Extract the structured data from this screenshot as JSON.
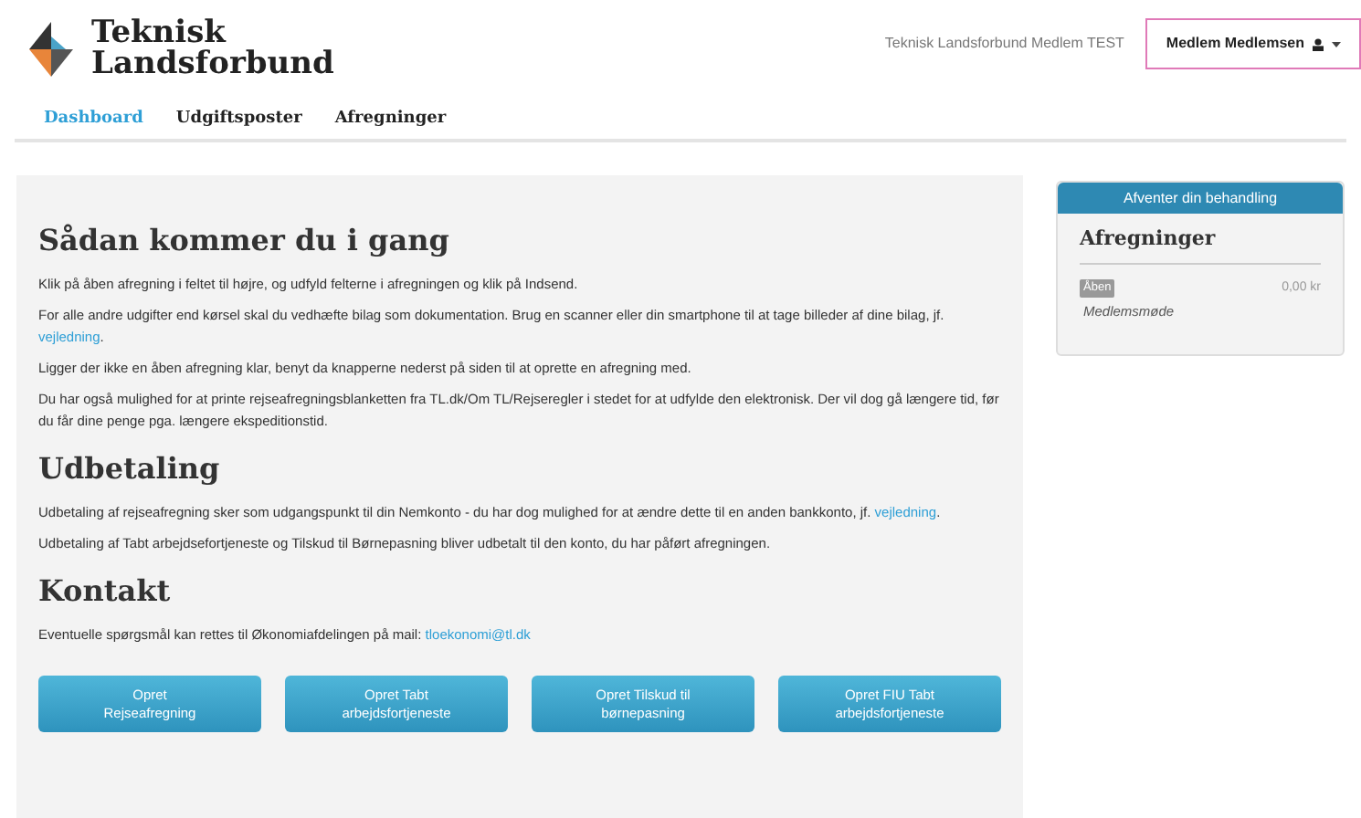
{
  "logo": {
    "line_1": "Teknisk",
    "line_2": "Landsforbund"
  },
  "header": {
    "org": "Teknisk Landsforbund Medlem TEST",
    "user": "Medlem Medlemsen"
  },
  "nav": [
    {
      "label": "Dashboard",
      "selected": true
    },
    {
      "label": "Udgiftsposter",
      "selected": false
    },
    {
      "label": "Afregninger",
      "selected": false
    }
  ],
  "sections": [
    {
      "title": "Sådan kommer du i gang",
      "paragraphs": [
        {
          "text": "Klik på åben afregning i feltet til højre, og udfyld felterne i afregningen og klik på Indsend."
        },
        {
          "text": "For alle andre udgifter end kørsel skal du vedhæfte bilag som dokumentation. Brug en scanner eller din smartphone til at tage billeder af dine bilag, jf. ",
          "link": "vejledning",
          "after": "."
        },
        {
          "text": "Ligger der ikke en åben afregning klar, benyt da knapperne nederst på siden til at oprette en afregning med."
        },
        {
          "text": "Du har også mulighed for at printe rejseafregningsblanketten fra TL.dk/Om TL/Rejseregler i stedet for at udfylde den elektronisk. Der vil dog gå længere tid, før du får dine penge pga. længere ekspeditionstid."
        }
      ]
    },
    {
      "title": "Udbetaling",
      "paragraphs": [
        {
          "text": "Udbetaling af rejseafregning sker som udgangspunkt til din Nemkonto - du har dog mulighed for at ændre dette til en anden bankkonto, jf. ",
          "link": "vejledning",
          "after": "."
        },
        {
          "text": "Udbetaling af Tabt arbejdsefortjeneste og Tilskud til Børnepasning bliver udbetalt til den konto, du har påført afregningen."
        }
      ]
    },
    {
      "title": "Kontakt",
      "paragraphs": [
        {
          "text": "Eventuelle spørgsmål kan rettes til Økonomiafdelingen på mail: ",
          "link": "tloekonomi@tl.dk"
        }
      ]
    }
  ],
  "buttons": [
    {
      "line_1": "Opret",
      "line_2": "Rejseafregning"
    },
    {
      "line_1": "Opret Tabt",
      "line_2": "arbejdsfortjeneste"
    },
    {
      "line_1": "Opret Tilskud til",
      "line_2": "børnepasning"
    },
    {
      "line_1": "Opret FIU Tabt",
      "line_2": "arbejdsfortjeneste"
    }
  ],
  "side_panel": {
    "header": "Afventer din behandling",
    "title": "Afregninger",
    "items": [
      {
        "badge": "Åben",
        "name": "Medlemsmøde",
        "amount": "0,00 kr"
      }
    ]
  }
}
